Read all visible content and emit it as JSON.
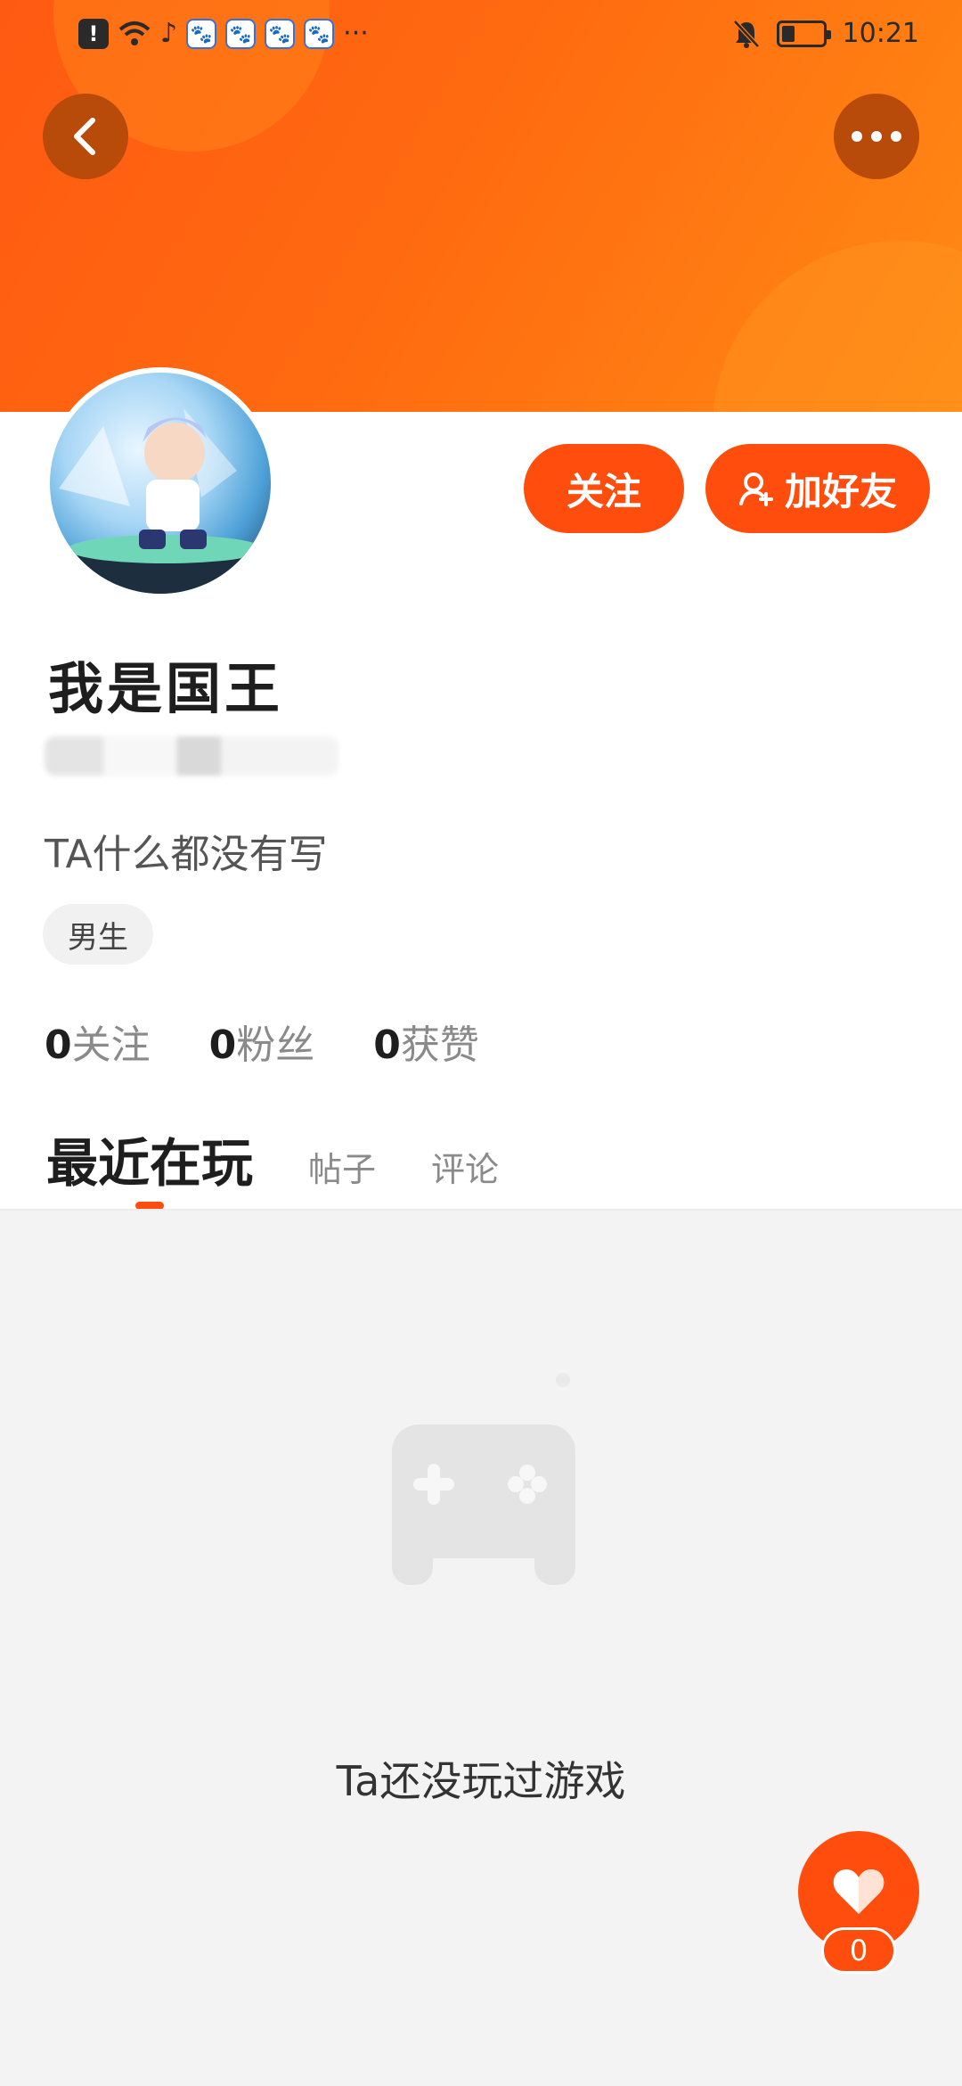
{
  "status_bar": {
    "time": "10:21",
    "overflow": "···",
    "alert_icon": "!",
    "tiktok_icon": "♪",
    "paw_icon": "🐾"
  },
  "header": {
    "back_icon": "chevron-left-icon",
    "more_icon": "more-dots-icon",
    "accent_color": "#ff4d0e"
  },
  "actions": {
    "follow_label": "关注",
    "add_friend_label": "加好友"
  },
  "profile": {
    "name": "我是国王",
    "bio": "TA什么都没有写",
    "gender_tag": "男生"
  },
  "stats": [
    {
      "num": "0",
      "label": "关注"
    },
    {
      "num": "0",
      "label": "粉丝"
    },
    {
      "num": "0",
      "label": "获赞"
    }
  ],
  "tabs": [
    {
      "label": "最近在玩"
    },
    {
      "label": "帖子"
    },
    {
      "label": "评论"
    }
  ],
  "empty_state": {
    "text": "Ta还没玩过游戏"
  },
  "like": {
    "count": "0"
  }
}
